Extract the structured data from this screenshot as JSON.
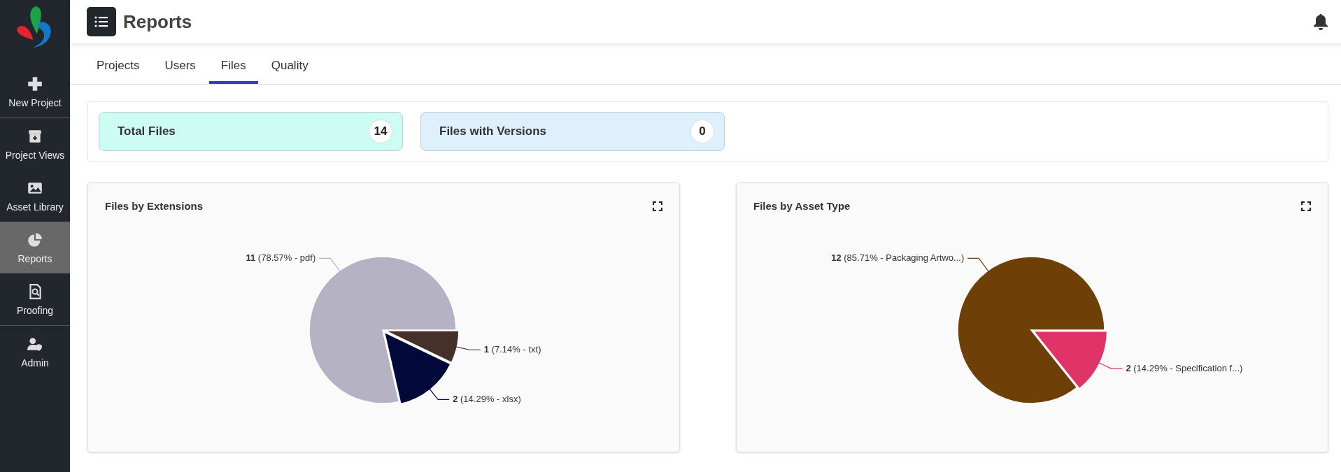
{
  "sidebar": {
    "items": [
      {
        "label": "New Project",
        "selected": false
      },
      {
        "label": "Project Views",
        "selected": false
      },
      {
        "label": "Asset Library",
        "selected": false
      },
      {
        "label": "Reports",
        "selected": true
      },
      {
        "label": "Proofing",
        "selected": false
      },
      {
        "label": "Admin",
        "selected": false
      }
    ]
  },
  "header": {
    "title": "Reports"
  },
  "tabs": [
    {
      "label": "Projects",
      "selected": false
    },
    {
      "label": "Users",
      "selected": false
    },
    {
      "label": "Files",
      "selected": true
    },
    {
      "label": "Quality",
      "selected": false
    }
  ],
  "stats": [
    {
      "label": "Total Files",
      "count": "14",
      "color": "#ccfcf3"
    },
    {
      "label": "Files with Versions",
      "count": "0",
      "color": "#def0fb"
    }
  ],
  "charts": [
    {
      "title": "Files by Extensions",
      "chart_data": {
        "type": "pie",
        "values": [
          1,
          2,
          11
        ],
        "colors": [
          "#45302a",
          "#000a3a",
          "#b5b3c3"
        ],
        "value_labels": [
          "**1** (7.14% - txt)",
          "**2** (14.29% - xlsx)",
          "**11** (78.57% - pdf)"
        ]
      }
    },
    {
      "title": "Files by Asset Type",
      "chart_data": {
        "type": "pie",
        "values": [
          2,
          12
        ],
        "colors": [
          "#e03368",
          "#6e3f07"
        ],
        "value_labels": [
          "**2** (14.29% - Specification f...)",
          "**12** (85.71% - Packaging Artwo...)"
        ]
      }
    }
  ]
}
